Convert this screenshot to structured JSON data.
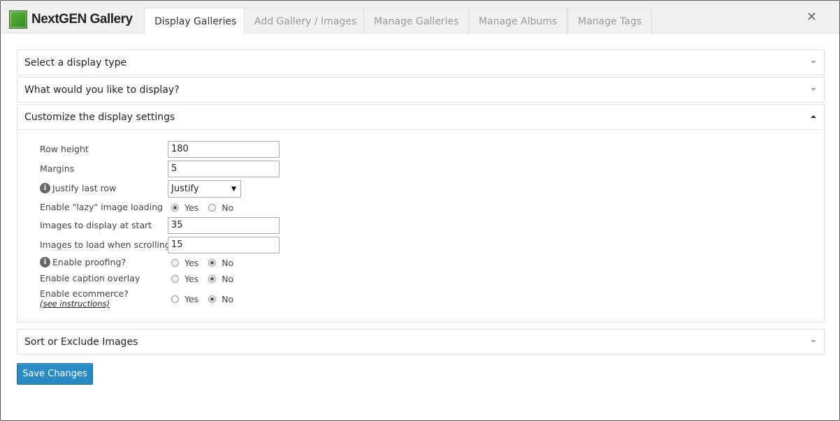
{
  "app": {
    "logo_text": "NextGEN Gallery"
  },
  "tabs": [
    {
      "label": "Display Galleries",
      "active": true
    },
    {
      "label": "Add Gallery / Images",
      "active": false
    },
    {
      "label": "Manage Galleries",
      "active": false
    },
    {
      "label": "Manage Albums",
      "active": false
    },
    {
      "label": "Manage Tags",
      "active": false
    }
  ],
  "close_symbol": "✕",
  "sections": {
    "display_type": "Select a display type",
    "what_display": "What would you like to display?",
    "customize": "Customize the display settings",
    "sort_exclude": "Sort or Exclude Images"
  },
  "settings": {
    "row_height": {
      "label": "Row height",
      "value": "180"
    },
    "margins": {
      "label": "Margins",
      "value": "5"
    },
    "justify_last_row": {
      "label": "Justify last row",
      "value": "Justify"
    },
    "lazy_loading": {
      "label": "Enable \"lazy\" image loading",
      "yes": "Yes",
      "no": "No",
      "selected": "Yes"
    },
    "images_at_start": {
      "label": "Images to display at start",
      "value": "35"
    },
    "images_scrolling": {
      "label": "Images to load when scrolling",
      "value": "15"
    },
    "proofing": {
      "label": "Enable proofing?",
      "yes": "Yes",
      "no": "No",
      "selected": "No"
    },
    "caption_overlay": {
      "label": "Enable caption overlay",
      "yes": "Yes",
      "no": "No",
      "selected": "No"
    },
    "ecommerce": {
      "label": "Enable ecommerce?",
      "link": "(see instructions)",
      "yes": "Yes",
      "no": "No",
      "selected": "No"
    }
  },
  "info_symbol": "i",
  "save_button": "Save Changes",
  "colors": {
    "primary_button": "#2a8bc4",
    "logo_green": "#3f9a2a"
  }
}
